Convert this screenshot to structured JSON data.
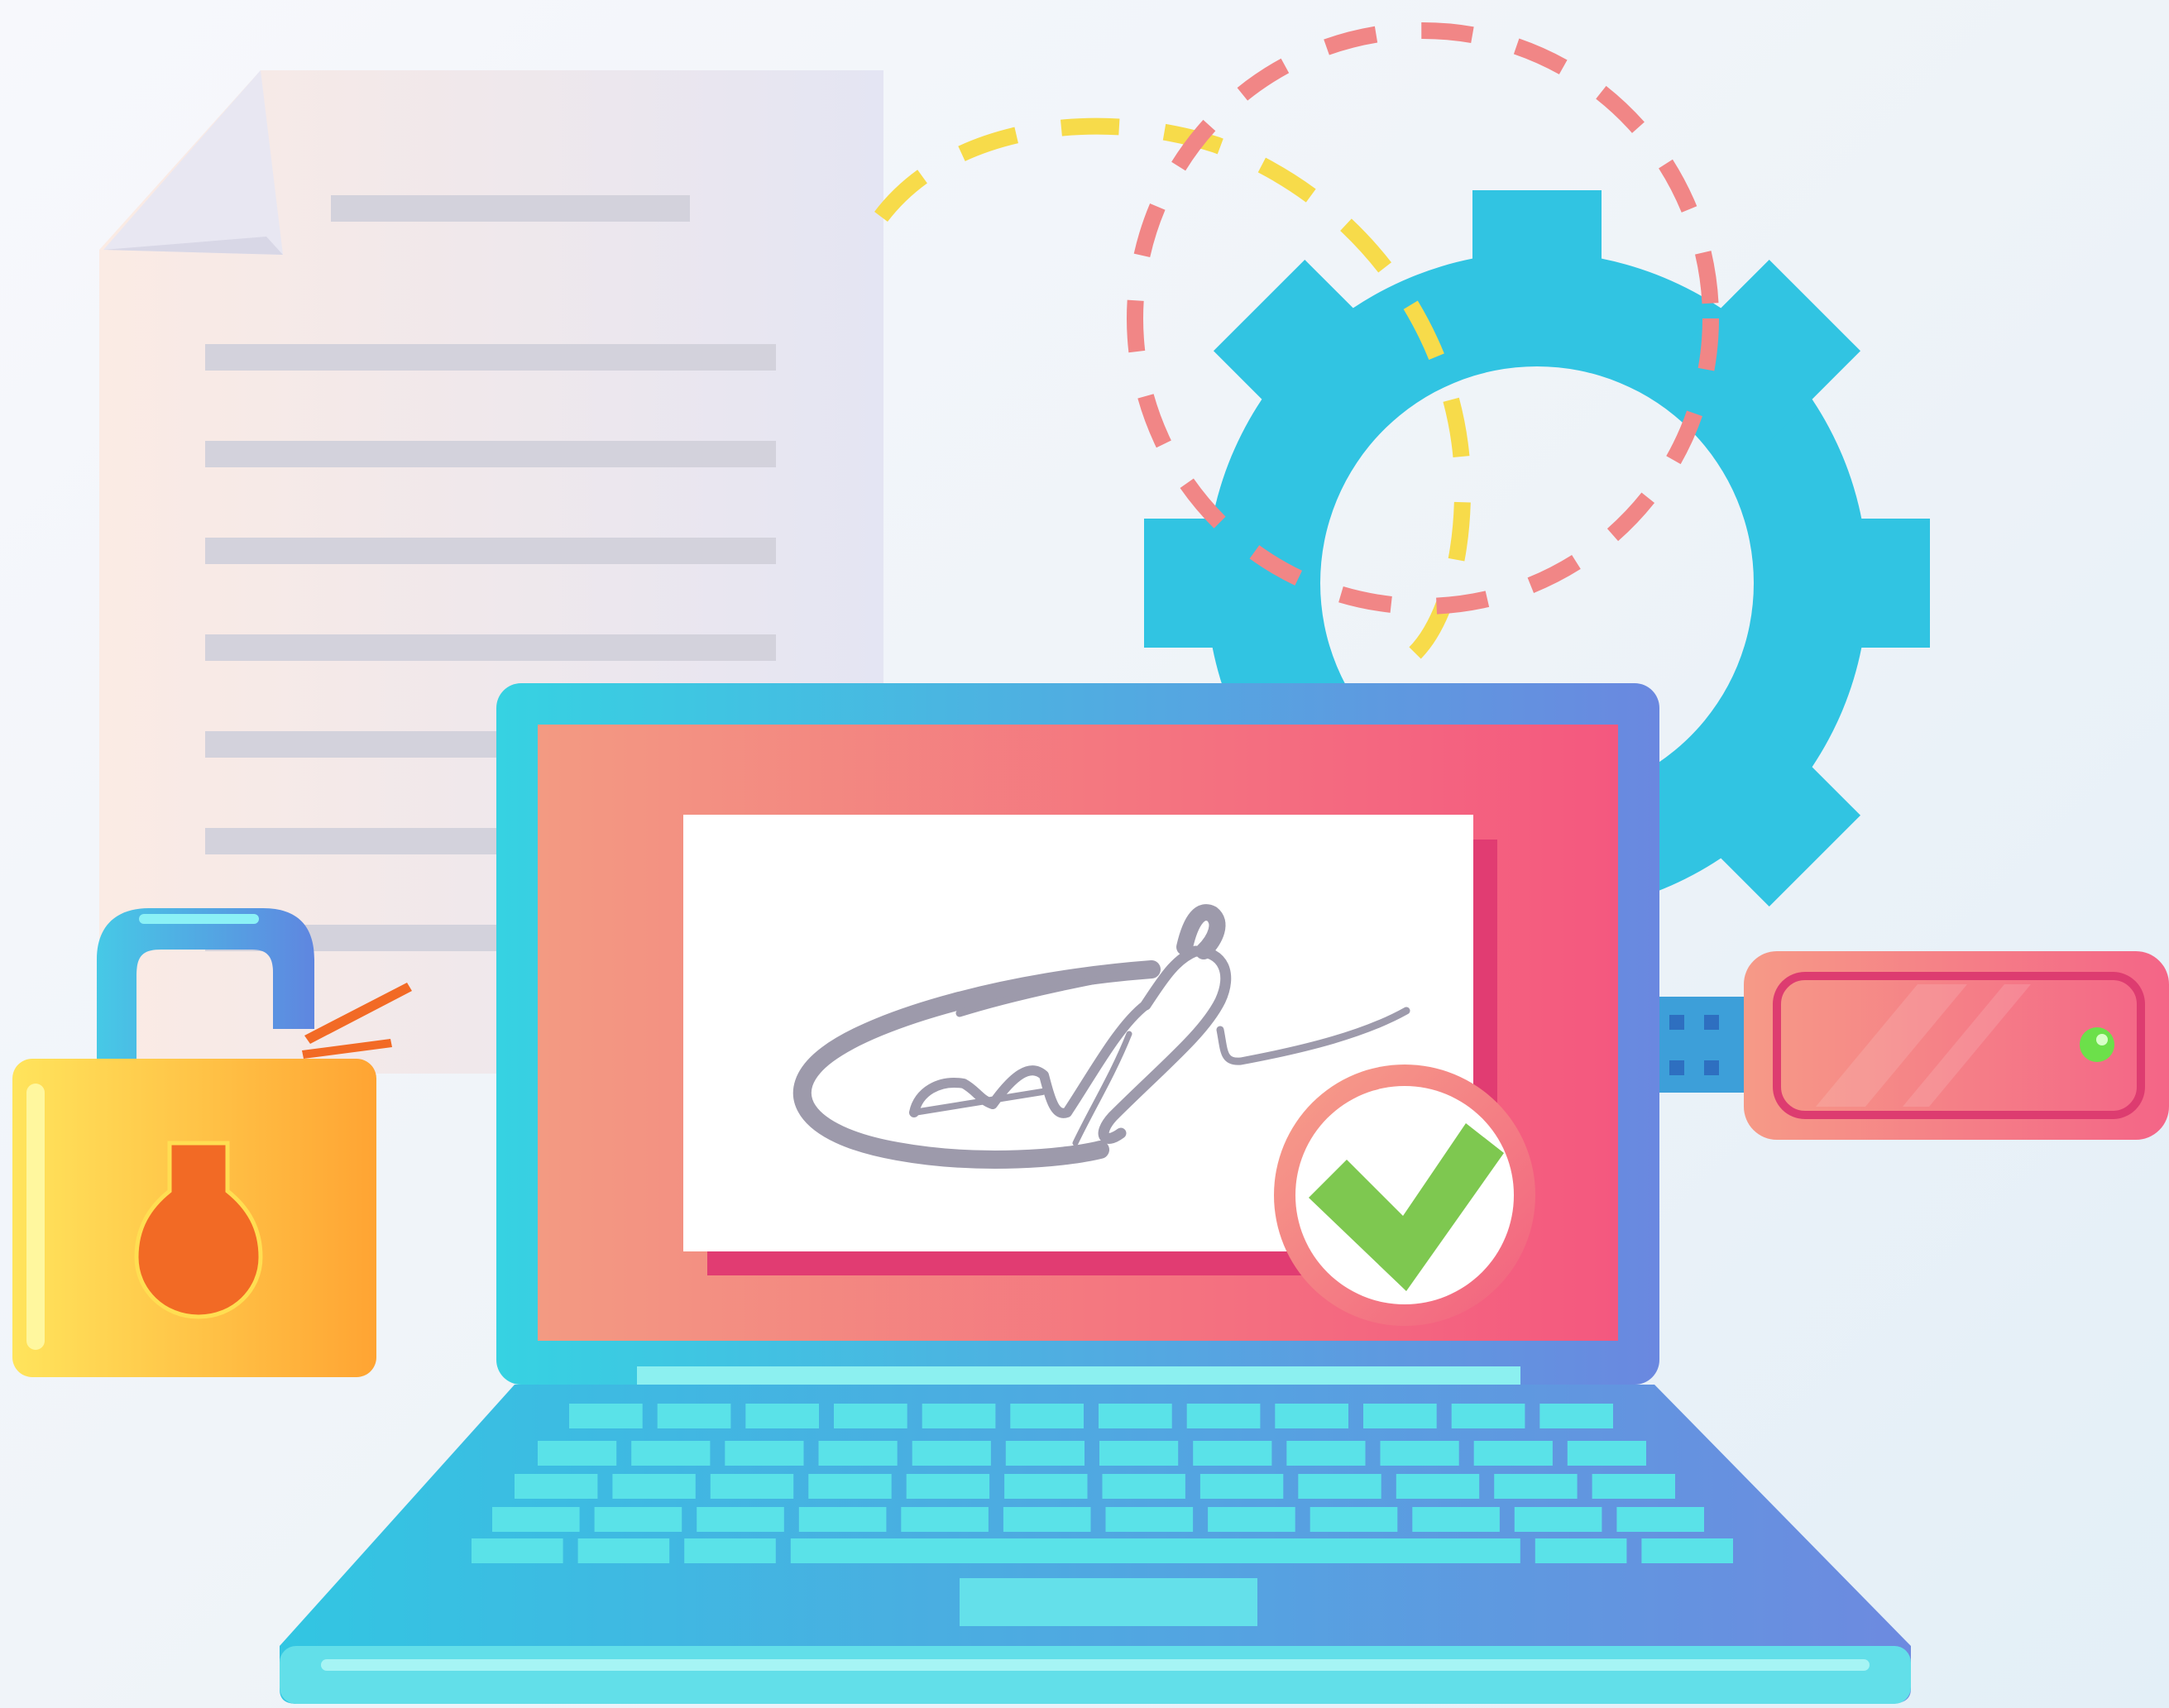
{
  "illustration": {
    "subject": "digital-signature",
    "icons": [
      "document-icon",
      "gear-icon",
      "padlock-icon",
      "laptop-icon",
      "signature-icon",
      "checkmark-icon",
      "usb-token-icon"
    ],
    "colors": {
      "gear": "#31c4e2",
      "screen_start": "#f39a82",
      "screen_end": "#f4587f",
      "laptop_start": "#36d2e2",
      "laptop_end": "#6a88e0",
      "padlock_start": "#ffe45c",
      "padlock_end": "#ffa433",
      "keyhole": "#f26a25",
      "check": "#7ec850",
      "signature": "#9d9aab",
      "dash_yellow": "#f7db4a",
      "dash_red": "#f18686",
      "usb_start": "#f69a87",
      "usb_end": "#f46587",
      "led": "#6ce04a"
    }
  }
}
